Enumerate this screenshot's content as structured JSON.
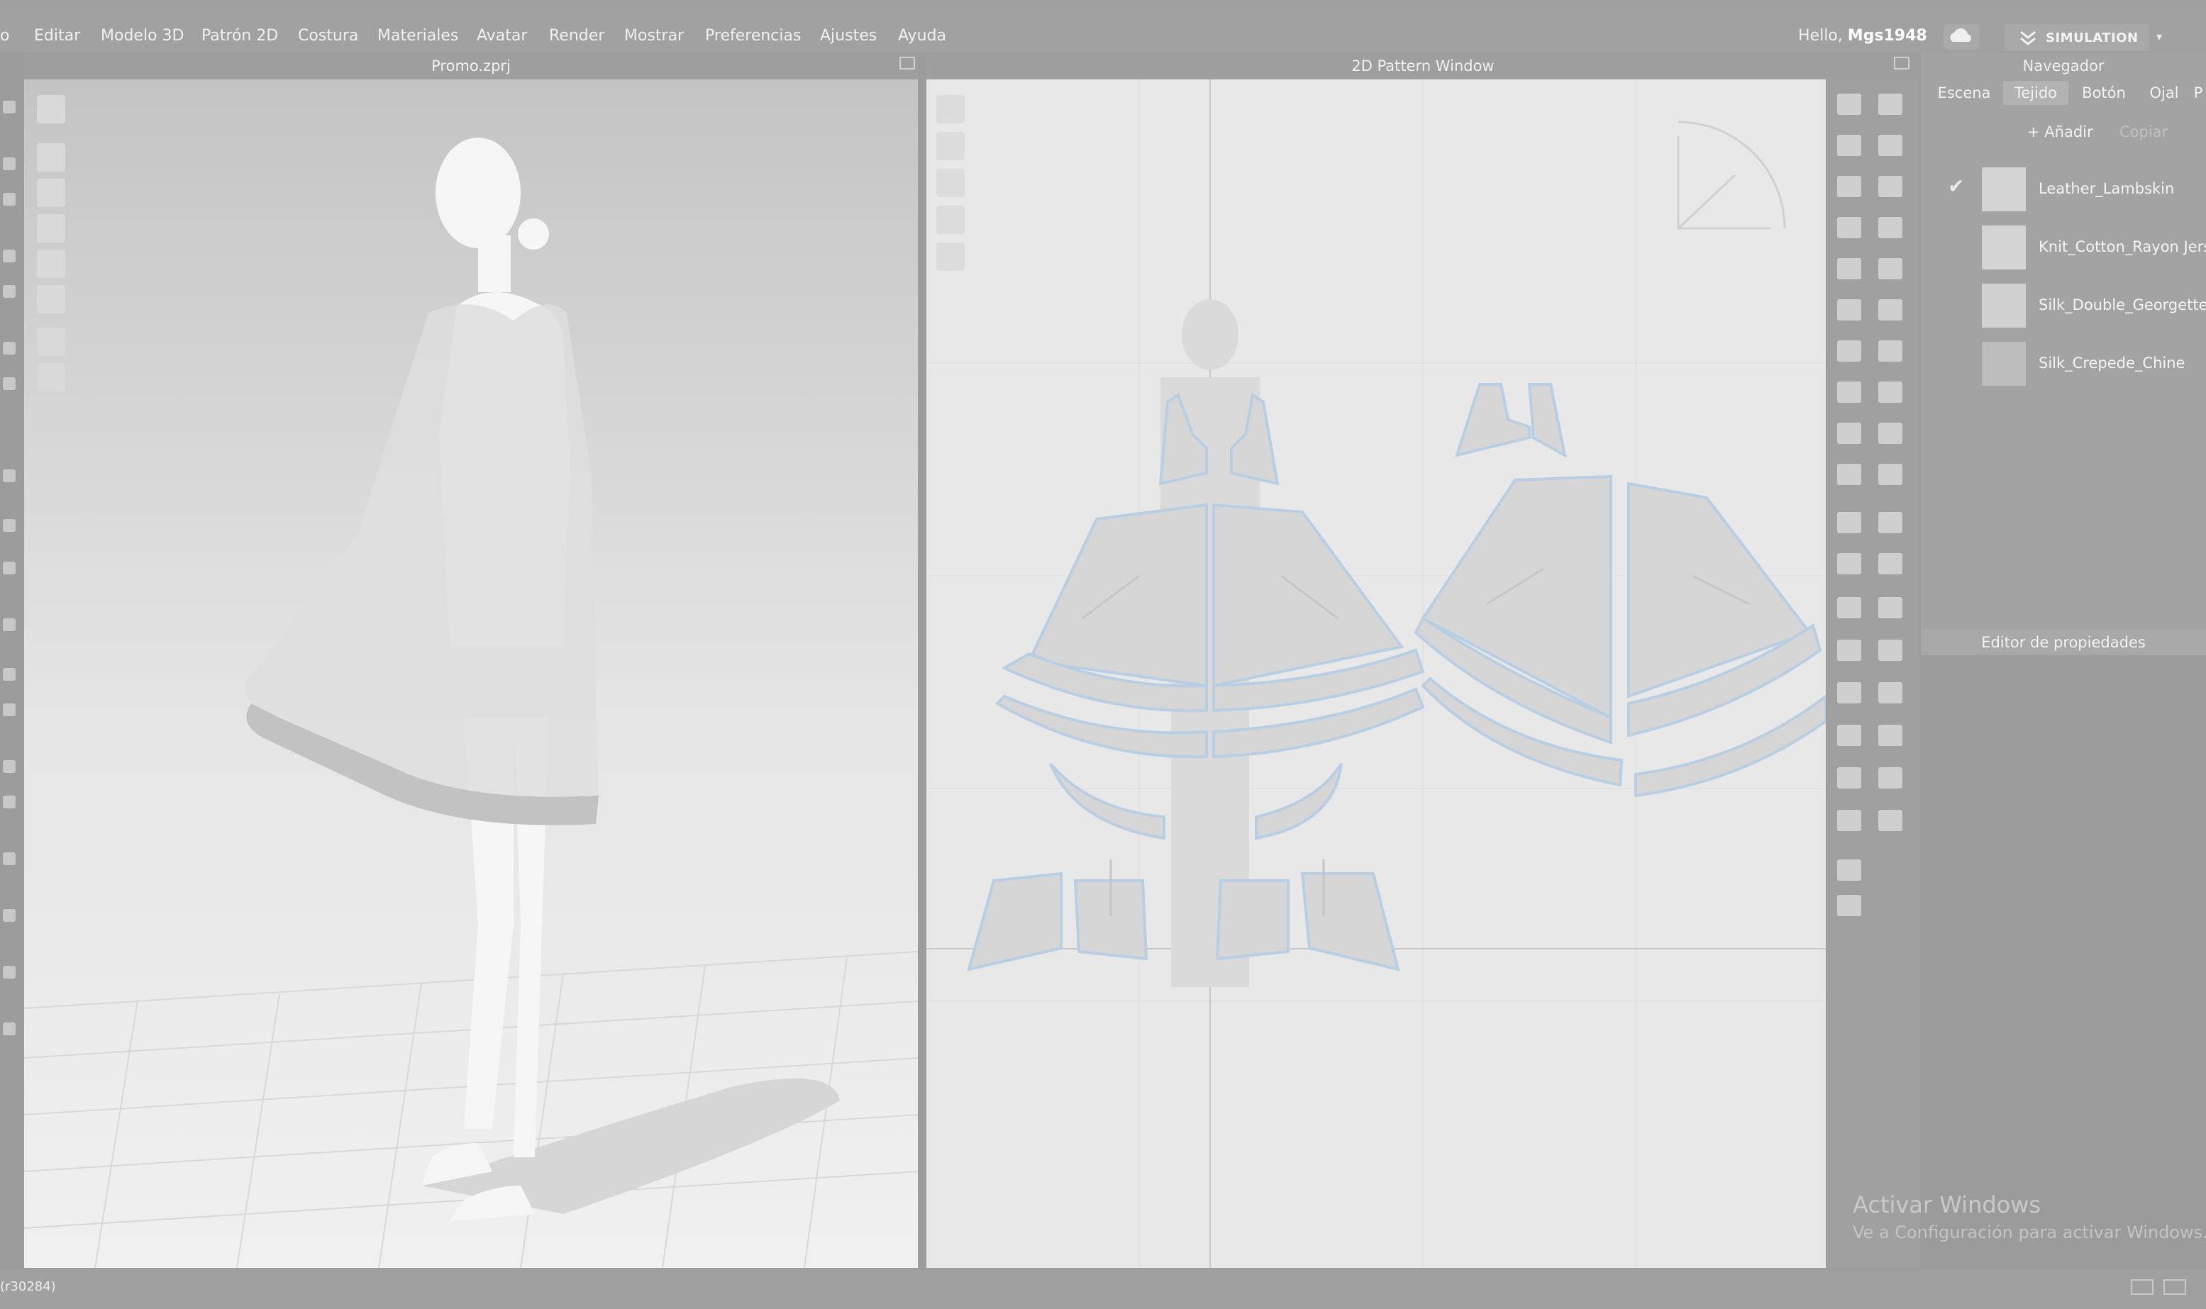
{
  "menu": {
    "items": [
      "o",
      "Editar",
      "Modelo 3D",
      "Patrón 2D",
      "Costura",
      "Materiales",
      "Avatar",
      "Render",
      "Mostrar",
      "Preferencias",
      "Ajustes",
      "Ayuda"
    ]
  },
  "user": {
    "greeting": "Hello,",
    "name": "Mgs1948"
  },
  "simulation_label": "SIMULATION",
  "panes": {
    "left_title": "Promo.zprj",
    "right_title": "2D Pattern Window"
  },
  "navigator": {
    "title": "Navegador",
    "tabs": [
      "Escena",
      "Tejido",
      "Botón",
      "Ojal",
      "P"
    ],
    "active_tab": "Tejido",
    "add_label": "+ Añadir",
    "copy_label": "Copiar",
    "fabrics": [
      {
        "name": "Leather_Lambskin",
        "checked": true
      },
      {
        "name": "Knit_Cotton_Rayon Jersey",
        "checked": false
      },
      {
        "name": "Silk_Double_Georgette (",
        "checked": false
      },
      {
        "name": "Silk_Crepede_Chine",
        "checked": false
      }
    ]
  },
  "property_editor": "Editor de propiedades",
  "activation": {
    "line1": "Activar Windows",
    "line2": "Ve a Configuración para activar Windows."
  },
  "status": {
    "version": "(r30284)"
  },
  "icons": {
    "cloud": "cloud-sync-icon",
    "simulation": "simulation-icon",
    "dropdown": "chevron-down-icon",
    "check": "check-icon",
    "float": "float-window-icon"
  }
}
